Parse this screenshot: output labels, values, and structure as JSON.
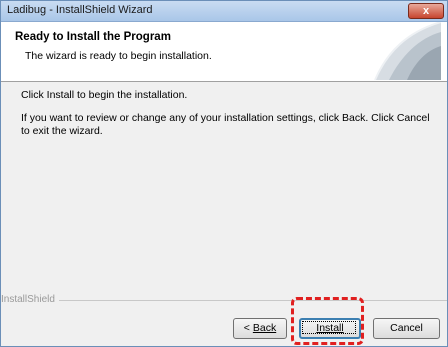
{
  "window": {
    "title": "Ladibug - InstallShield Wizard",
    "close_glyph": "x"
  },
  "header": {
    "title": "Ready to Install the Program",
    "subtitle": "The wizard is ready to begin installation."
  },
  "body": {
    "line1": "Click Install to begin the installation.",
    "line2": "If you want to review or change any of your installation settings, click Back. Click Cancel to exit the wizard."
  },
  "footer": {
    "brand": "InstallShield"
  },
  "buttons": {
    "back_prefix": "< ",
    "back": "Back",
    "install": "Install",
    "cancel": "Cancel"
  },
  "colors": {
    "highlight": "#e02020",
    "title_bar": "#a9c6e8"
  }
}
